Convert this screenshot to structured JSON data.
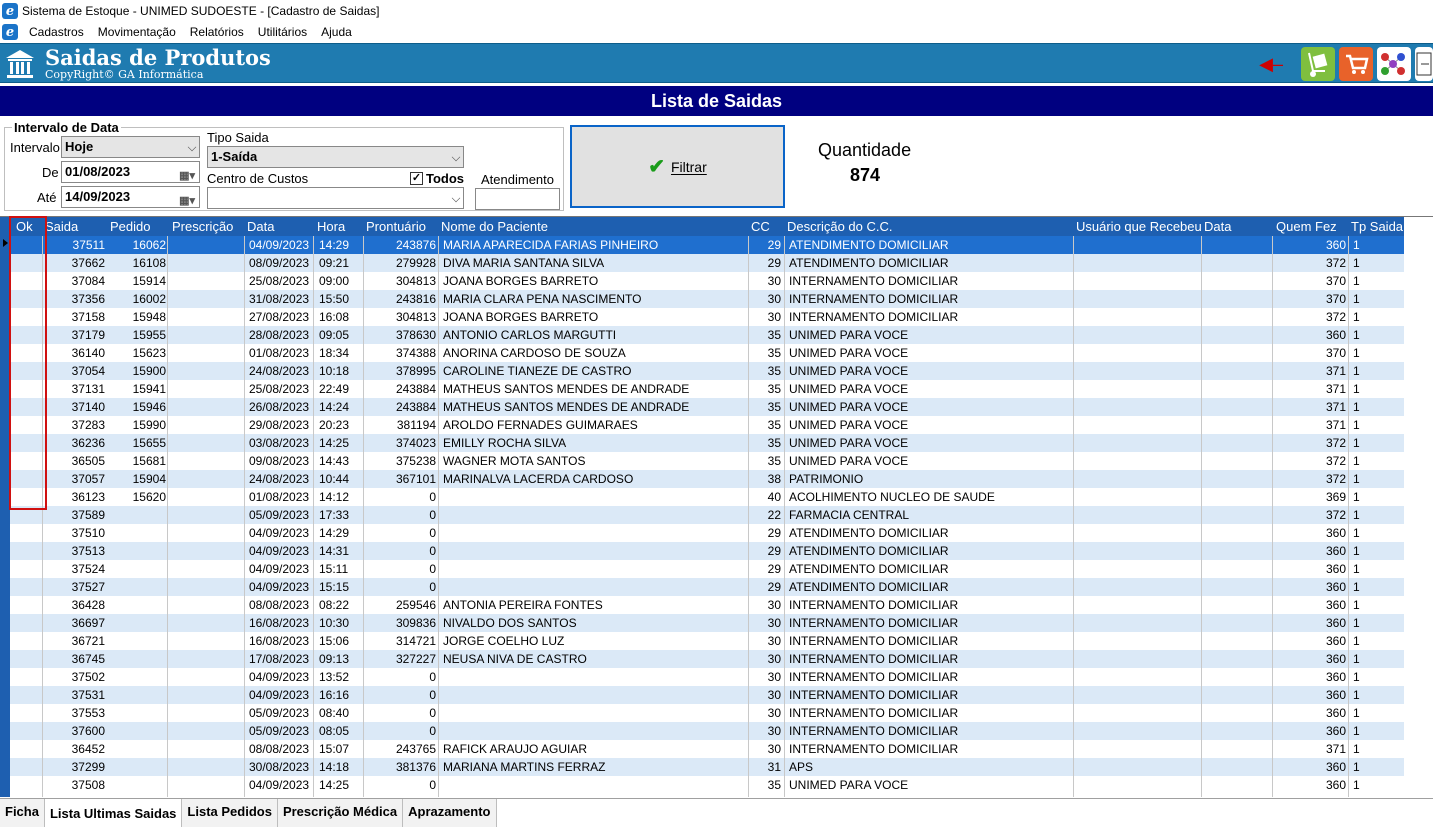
{
  "window": {
    "title": "Sistema de Estoque - UNIMED SUDOESTE - [Cadastro de Saidas]",
    "app_icon": "e-logo-icon"
  },
  "menu": [
    "Cadastros",
    "Movimentação",
    "Relatórios",
    "Utilitários",
    "Ajuda"
  ],
  "banner": {
    "title": "Saidas de Produtos",
    "subtitle": "CopyRight© GA Informática",
    "color": "#1f7bb0"
  },
  "header": {
    "title": "Lista de Saidas",
    "color": "#000080"
  },
  "filters": {
    "group_label": "Intervalo de Data",
    "intervalo_label": "Intervalo",
    "intervalo_value": "Hoje",
    "de_label": "De",
    "de_value": "01/08/2023",
    "ate_label": "Até",
    "ate_value": "14/09/2023",
    "tipo_saida_label": "Tipo Saida",
    "tipo_saida_value": "1-Saída",
    "centro_custos_label": "Centro de Custos",
    "centro_custos_value": "",
    "todos_label": "Todos",
    "todos_checked": true,
    "atendimento_label": "Atendimento",
    "atendimento_value": ""
  },
  "filtrar_button": {
    "label": "Filtrar",
    "icon": "checkmark-icon"
  },
  "quantidade": {
    "label": "Quantidade",
    "value": "874"
  },
  "grid": {
    "columns": [
      "Ok",
      "Saida",
      "Pedido",
      "Prescrição",
      "Data",
      "Hora",
      "Prontuário",
      "Nome do Paciente",
      "CC",
      "Descrição do C.C.",
      "Usuário que Recebeu",
      "Data",
      "Quem Fez",
      "Tp Saida"
    ],
    "rows": [
      [
        "37511",
        "16062",
        "",
        "04/09/2023",
        "14:29",
        "243876",
        "MARIA APARECIDA FARIAS PINHEIRO",
        "29",
        "ATENDIMENTO DOMICILIAR",
        "",
        "",
        "360",
        "1"
      ],
      [
        "37662",
        "16108",
        "",
        "08/09/2023",
        "09:21",
        "279928",
        "DIVA MARIA SANTANA SILVA",
        "29",
        "ATENDIMENTO DOMICILIAR",
        "",
        "",
        "372",
        "1"
      ],
      [
        "37084",
        "15914",
        "",
        "25/08/2023",
        "09:00",
        "304813",
        "JOANA BORGES BARRETO",
        "30",
        "INTERNAMENTO DOMICILIAR",
        "",
        "",
        "370",
        "1"
      ],
      [
        "37356",
        "16002",
        "",
        "31/08/2023",
        "15:50",
        "243816",
        "MARIA CLARA PENA NASCIMENTO",
        "30",
        "INTERNAMENTO DOMICILIAR",
        "",
        "",
        "370",
        "1"
      ],
      [
        "37158",
        "15948",
        "",
        "27/08/2023",
        "16:08",
        "304813",
        "JOANA BORGES BARRETO",
        "30",
        "INTERNAMENTO DOMICILIAR",
        "",
        "",
        "372",
        "1"
      ],
      [
        "37179",
        "15955",
        "",
        "28/08/2023",
        "09:05",
        "378630",
        "ANTONIO CARLOS MARGUTTI",
        "35",
        "UNIMED PARA VOCE",
        "",
        "",
        "360",
        "1"
      ],
      [
        "36140",
        "15623",
        "",
        "01/08/2023",
        "18:34",
        "374388",
        "ANORINA CARDOSO DE SOUZA",
        "35",
        "UNIMED PARA VOCE",
        "",
        "",
        "370",
        "1"
      ],
      [
        "37054",
        "15900",
        "",
        "24/08/2023",
        "10:18",
        "378995",
        "CAROLINE TIANEZE DE CASTRO",
        "35",
        "UNIMED PARA VOCE",
        "",
        "",
        "371",
        "1"
      ],
      [
        "37131",
        "15941",
        "",
        "25/08/2023",
        "22:49",
        "243884",
        "MATHEUS SANTOS MENDES DE ANDRADE",
        "35",
        "UNIMED PARA VOCE",
        "",
        "",
        "371",
        "1"
      ],
      [
        "37140",
        "15946",
        "",
        "26/08/2023",
        "14:24",
        "243884",
        "MATHEUS SANTOS MENDES DE ANDRADE",
        "35",
        "UNIMED PARA VOCE",
        "",
        "",
        "371",
        "1"
      ],
      [
        "37283",
        "15990",
        "",
        "29/08/2023",
        "20:23",
        "381194",
        "AROLDO FERNADES GUIMARAES",
        "35",
        "UNIMED PARA VOCE",
        "",
        "",
        "371",
        "1"
      ],
      [
        "36236",
        "15655",
        "",
        "03/08/2023",
        "14:25",
        "374023",
        "EMILLY ROCHA SILVA",
        "35",
        "UNIMED PARA VOCE",
        "",
        "",
        "372",
        "1"
      ],
      [
        "36505",
        "15681",
        "",
        "09/08/2023",
        "14:43",
        "375238",
        "WAGNER MOTA SANTOS",
        "35",
        "UNIMED PARA VOCE",
        "",
        "",
        "372",
        "1"
      ],
      [
        "37057",
        "15904",
        "",
        "24/08/2023",
        "10:44",
        "367101",
        "MARINALVA LACERDA CARDOSO",
        "38",
        "PATRIMONIO",
        "",
        "",
        "372",
        "1"
      ],
      [
        "36123",
        "15620",
        "",
        "01/08/2023",
        "14:12",
        "0",
        "",
        "40",
        "ACOLHIMENTO NUCLEO DE SAUDE",
        "",
        "",
        "369",
        "1"
      ],
      [
        "37589",
        "",
        "",
        "05/09/2023",
        "17:33",
        "0",
        "",
        "22",
        "FARMACIA CENTRAL",
        "",
        "",
        "372",
        "1"
      ],
      [
        "37510",
        "",
        "",
        "04/09/2023",
        "14:29",
        "0",
        "",
        "29",
        "ATENDIMENTO DOMICILIAR",
        "",
        "",
        "360",
        "1"
      ],
      [
        "37513",
        "",
        "",
        "04/09/2023",
        "14:31",
        "0",
        "",
        "29",
        "ATENDIMENTO DOMICILIAR",
        "",
        "",
        "360",
        "1"
      ],
      [
        "37524",
        "",
        "",
        "04/09/2023",
        "15:11",
        "0",
        "",
        "29",
        "ATENDIMENTO DOMICILIAR",
        "",
        "",
        "360",
        "1"
      ],
      [
        "37527",
        "",
        "",
        "04/09/2023",
        "15:15",
        "0",
        "",
        "29",
        "ATENDIMENTO DOMICILIAR",
        "",
        "",
        "360",
        "1"
      ],
      [
        "36428",
        "",
        "",
        "08/08/2023",
        "08:22",
        "259546",
        "ANTONIA PEREIRA FONTES",
        "30",
        "INTERNAMENTO DOMICILIAR",
        "",
        "",
        "360",
        "1"
      ],
      [
        "36697",
        "",
        "",
        "16/08/2023",
        "10:30",
        "309836",
        "NIVALDO DOS SANTOS",
        "30",
        "INTERNAMENTO DOMICILIAR",
        "",
        "",
        "360",
        "1"
      ],
      [
        "36721",
        "",
        "",
        "16/08/2023",
        "15:06",
        "314721",
        "JORGE COELHO LUZ",
        "30",
        "INTERNAMENTO DOMICILIAR",
        "",
        "",
        "360",
        "1"
      ],
      [
        "36745",
        "",
        "",
        "17/08/2023",
        "09:13",
        "327227",
        "NEUSA NIVA DE CASTRO",
        "30",
        "INTERNAMENTO DOMICILIAR",
        "",
        "",
        "360",
        "1"
      ],
      [
        "37502",
        "",
        "",
        "04/09/2023",
        "13:52",
        "0",
        "",
        "30",
        "INTERNAMENTO DOMICILIAR",
        "",
        "",
        "360",
        "1"
      ],
      [
        "37531",
        "",
        "",
        "04/09/2023",
        "16:16",
        "0",
        "",
        "30",
        "INTERNAMENTO DOMICILIAR",
        "",
        "",
        "360",
        "1"
      ],
      [
        "37553",
        "",
        "",
        "05/09/2023",
        "08:40",
        "0",
        "",
        "30",
        "INTERNAMENTO DOMICILIAR",
        "",
        "",
        "360",
        "1"
      ],
      [
        "37600",
        "",
        "",
        "05/09/2023",
        "08:05",
        "0",
        "",
        "30",
        "INTERNAMENTO DOMICILIAR",
        "",
        "",
        "360",
        "1"
      ],
      [
        "36452",
        "",
        "",
        "08/08/2023",
        "15:07",
        "243765",
        "RAFICK ARAUJO AGUIAR",
        "30",
        "INTERNAMENTO DOMICILIAR",
        "",
        "",
        "371",
        "1"
      ],
      [
        "37299",
        "",
        "",
        "30/08/2023",
        "14:18",
        "381376",
        "MARIANA MARTINS FERRAZ",
        "31",
        "APS",
        "",
        "",
        "360",
        "1"
      ],
      [
        "37508",
        "",
        "",
        "04/09/2023",
        "14:25",
        "0",
        "",
        "35",
        "UNIMED PARA VOCE",
        "",
        "",
        "360",
        "1"
      ]
    ]
  },
  "tabs": [
    "Ficha",
    "Lista Ultimas Saidas",
    "Lista Pedidos",
    "Prescrição Médica",
    "Aprazamento"
  ],
  "active_tab": "Lista Ultimas Saidas",
  "colors": {
    "grid_header": "#1e5fb0",
    "selected_row": "#1f6fcf",
    "alt_row": "#dbe9f7",
    "highlight_box": "#d01010"
  }
}
